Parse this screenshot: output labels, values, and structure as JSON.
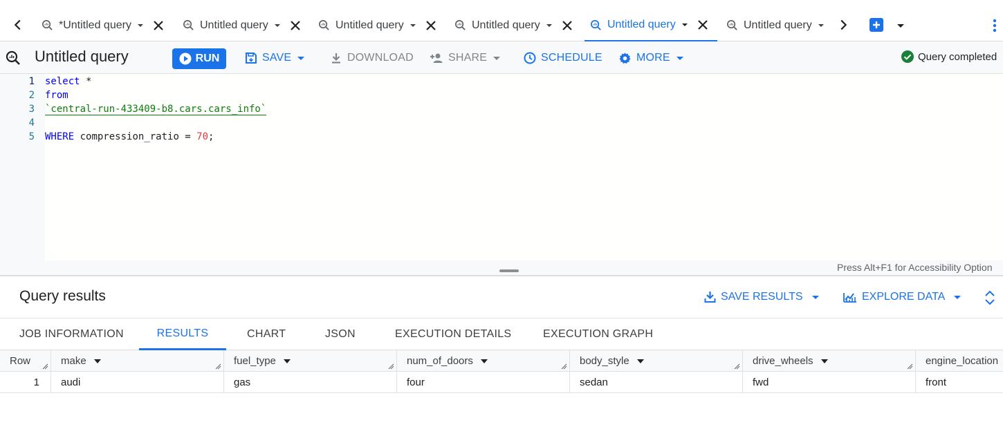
{
  "tabs": [
    {
      "label": "*Untitled query",
      "active": false
    },
    {
      "label": "Untitled query",
      "active": false
    },
    {
      "label": "Untitled query",
      "active": false
    },
    {
      "label": "Untitled query",
      "active": false
    },
    {
      "label": "Untitled query",
      "active": true
    },
    {
      "label": "Untitled query",
      "active": false
    }
  ],
  "toolbar": {
    "title": "Untitled query",
    "run": "RUN",
    "save": "SAVE",
    "download": "DOWNLOAD",
    "share": "SHARE",
    "schedule": "SCHEDULE",
    "more": "MORE",
    "status": "Query completed"
  },
  "editor": {
    "line_numbers": [
      "1",
      "2",
      "3",
      "4",
      "5"
    ],
    "lines": {
      "l1_kw": "select",
      "l1_rest": " *",
      "l2_kw": "from",
      "l3_table": "`central-run-433409-b8.cars.cars_info`",
      "l5_kw": "WHERE",
      "l5_col": " compression_ratio = ",
      "l5_num": "70",
      "l5_end": ";"
    },
    "accessibility_hint": "Press Alt+F1 for Accessibility Option"
  },
  "results": {
    "title": "Query results",
    "save_results": "SAVE RESULTS",
    "explore_data": "EXPLORE DATA",
    "tabs": [
      "JOB INFORMATION",
      "RESULTS",
      "CHART",
      "JSON",
      "EXECUTION DETAILS",
      "EXECUTION GRAPH"
    ],
    "active_tab": "RESULTS",
    "columns": [
      "Row",
      "make",
      "fuel_type",
      "num_of_doors",
      "body_style",
      "drive_wheels",
      "engine_location"
    ],
    "rows": [
      [
        "1",
        "audi",
        "gas",
        "four",
        "sedan",
        "fwd",
        "front"
      ]
    ]
  },
  "colors": {
    "accent": "#1a73e8",
    "success": "#188038"
  }
}
